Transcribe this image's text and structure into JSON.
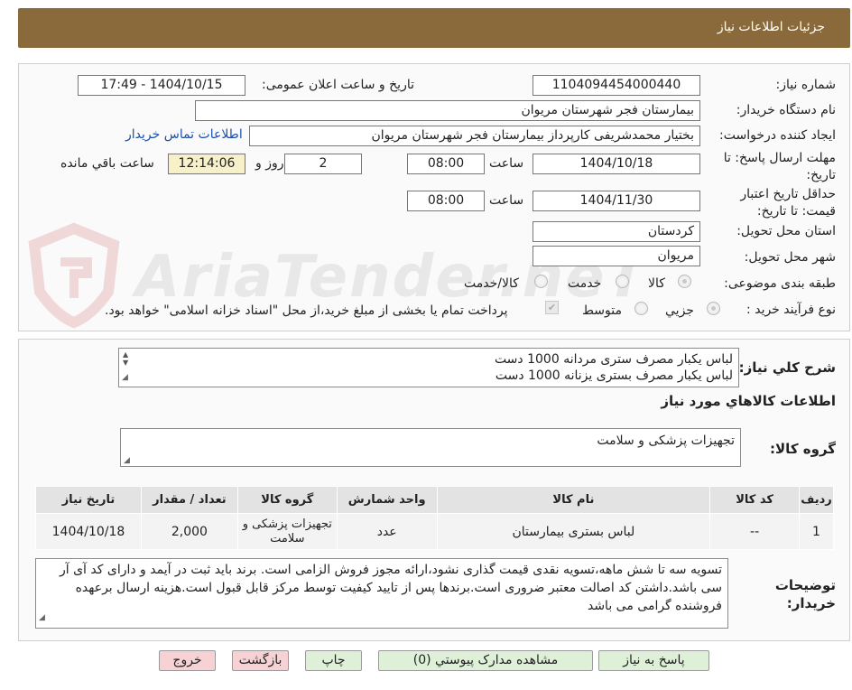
{
  "header": {
    "title": "جزئیات اطلاعات نیاز"
  },
  "watermark": {
    "text": "AriaTender.neT"
  },
  "form": {
    "need_number_label": "شماره نیاز:",
    "need_number": "1104094454000440",
    "announce_label": "تاریخ و ساعت اعلان عمومی:",
    "announce_value": "1404/10/15 - 17:49",
    "buyer_label": "نام دستگاه خریدار:",
    "buyer_value": "بیمارستان فجر شهرستان مریوان",
    "creator_label": "ایجاد کننده درخواست:",
    "creator_value": "بختیار محمدشریفی کارپرداز بیمارستان فجر شهرستان مریوان",
    "contact_link": "اطلاعات تماس خریدار",
    "deadline_label": "مهلت ارسال پاسخ: تا تاریخ:",
    "deadline_date": "1404/10/18",
    "time_label": "ساعت",
    "deadline_time": "08:00",
    "days_value": "2",
    "days_label": "روز و",
    "remaining_time": "12:14:06",
    "remaining_label": "ساعت باقي مانده",
    "validity_label": "حداقل تاریخ اعتبار قیمت: تا تاریخ:",
    "validity_date": "1404/11/30",
    "validity_time": "08:00",
    "province_label": "استان محل تحویل:",
    "province_value": "کردستان",
    "city_label": "شهر محل تحویل:",
    "city_value": "مریوان",
    "category_label": "طبقه بندی موضوعی:",
    "category_options": [
      "کالا",
      "خدمت",
      "کالا/خدمت"
    ],
    "process_label": "نوع فرآیند خرید :",
    "process_options": [
      "جزیي",
      "متوسط"
    ],
    "payment_note": "پرداخت تمام یا بخشی از مبلغ خرید،از محل \"اسناد خزانه اسلامی\" خواهد بود."
  },
  "summary": {
    "label": "شرح کلي نیاز:",
    "lines": [
      "لباس یکبار مصرف ستری مردانه 1000 دست",
      "لباس یکبار مصرف بستری  یزنانه 1000 دست"
    ],
    "goods_info_title": "اطلاعات کالاهاي مورد نیاز",
    "group_label": "گروه کالا:",
    "group_value": "تجهیزات پزشکی و سلامت"
  },
  "table": {
    "headers": [
      "ردیف",
      "کد کالا",
      "نام کالا",
      "واحد شمارش",
      "گروه کالا",
      "تعداد / مقدار",
      "تاریخ نیاز"
    ],
    "rows": [
      [
        "1",
        "--",
        "لباس بستری بیمارستان",
        "عدد",
        "تجهیزات پزشکی و سلامت",
        "2,000",
        "1404/10/18"
      ]
    ]
  },
  "notes": {
    "label": "توضیحات خریدار:",
    "text": "تسویه سه تا شش ماهه،تسویه نقدی قیمت گذاری نشود،ارائه مجوز فروش الزامی است. برند باید ثبت در آیمد و دارای کد آی آر سی باشد.داشتن کد اصالت معتبر ضروری است.برندها پس از تایید کیفیت توسط مرکز قابل قبول است.هزینه ارسال برعهده فروشنده گرامی می باشد"
  },
  "buttons": {
    "reply": "پاسخ به نیاز",
    "attachments": "مشاهده مدارک پیوستي (0)",
    "print": "چاپ",
    "back": "بازگشت",
    "exit": "خروج"
  }
}
